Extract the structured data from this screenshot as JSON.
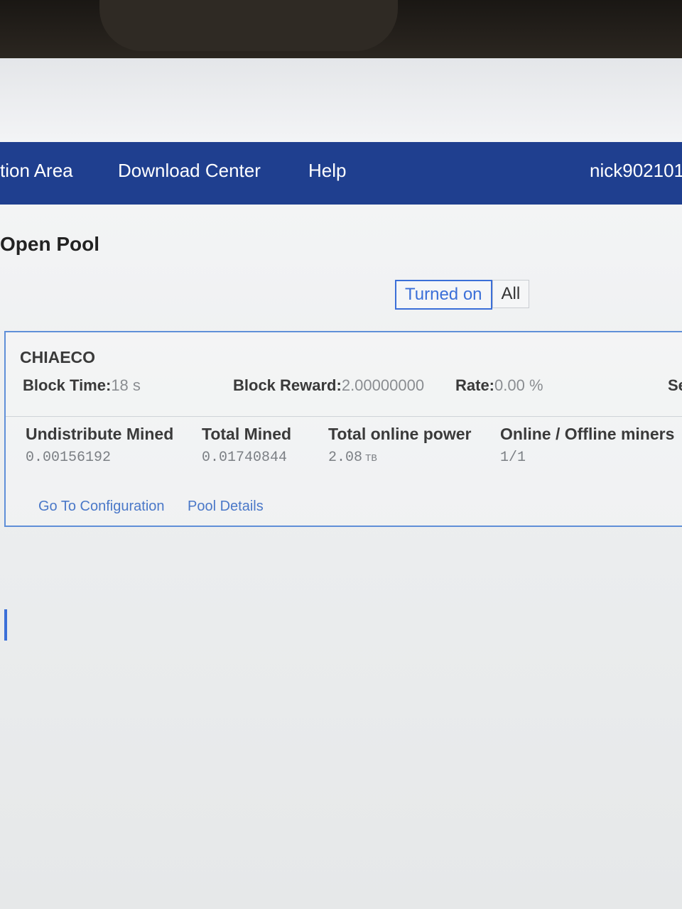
{
  "navbar": {
    "items": [
      "tion Area",
      "Download Center",
      "Help"
    ],
    "username": "nick902101"
  },
  "page": {
    "title": "Open Pool",
    "filter": {
      "options": [
        "Turned on",
        "All"
      ],
      "selected": "Turned on"
    }
  },
  "pool": {
    "name": "CHIAECO",
    "block_time_label": "Block Time:",
    "block_time_value": "18 s",
    "block_reward_label": "Block Reward:",
    "block_reward_value": "2.00000000",
    "rate_label": "Rate:",
    "rate_value": "0.00 %",
    "truncated_label": "Se",
    "metrics": [
      {
        "label": "Undistribute Mined",
        "value": "0.00156192",
        "unit": ""
      },
      {
        "label": "Total Mined",
        "value": "0.01740844",
        "unit": ""
      },
      {
        "label": "Total online power",
        "value": "2.08",
        "unit": "TB"
      },
      {
        "label": "Online / Offline miners",
        "value": "1/1",
        "unit": ""
      }
    ],
    "links": {
      "config": "Go To Configuration",
      "details": "Pool Details"
    }
  },
  "colors": {
    "navbar": "#1f3f8f",
    "accent": "#3b6fd8",
    "link": "#4a78c8",
    "card_border": "#5f8fd8"
  }
}
